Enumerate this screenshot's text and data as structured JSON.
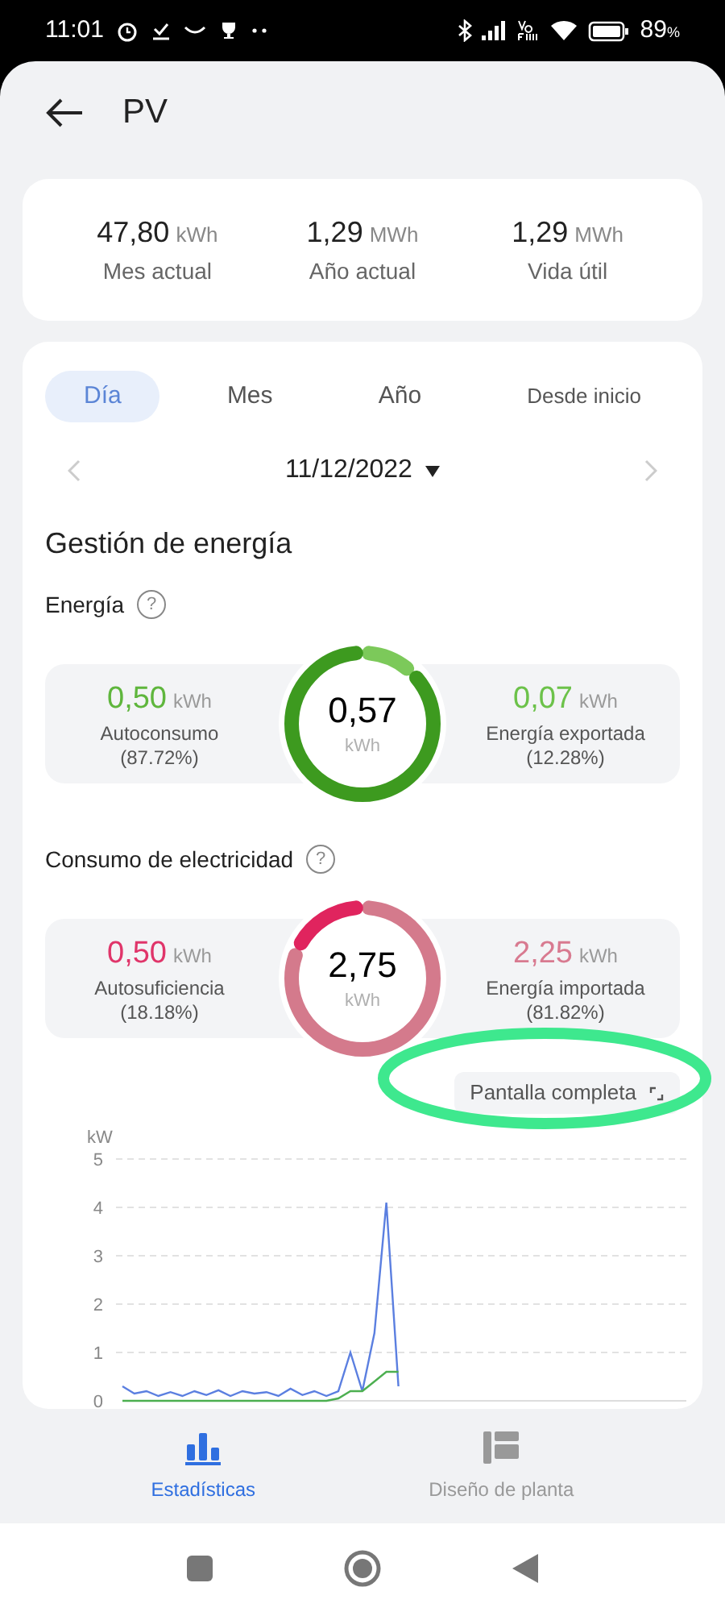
{
  "status_bar": {
    "time": "11:01",
    "battery": "89",
    "battery_unit": "%"
  },
  "header": {
    "title": "PV"
  },
  "summary": [
    {
      "value": "47,80",
      "unit": "kWh",
      "label": "Mes actual"
    },
    {
      "value": "1,29",
      "unit": "MWh",
      "label": "Año actual"
    },
    {
      "value": "1,29",
      "unit": "MWh",
      "label": "Vida útil"
    }
  ],
  "period_tabs": [
    {
      "label": "Día",
      "selected": true
    },
    {
      "label": "Mes",
      "selected": false
    },
    {
      "label": "Año",
      "selected": false
    },
    {
      "label": "Desde inicio",
      "selected": false
    }
  ],
  "date": "11/12/2022",
  "section_title": "Gestión de energía",
  "gauges": [
    {
      "kind": "green",
      "title": "Energía",
      "help_icon": "?",
      "total": "0,57",
      "total_unit": "kWh",
      "left": {
        "value": "0,50",
        "unit": "kWh",
        "label": "Autoconsumo",
        "percent": "(87.72%)"
      },
      "right": {
        "value": "0,07",
        "unit": "kWh",
        "label": "Energía exportada",
        "percent": "(12.28%)"
      }
    },
    {
      "kind": "pink",
      "title": "Consumo de electricidad",
      "help_icon": "?",
      "total": "2,75",
      "total_unit": "kWh",
      "left": {
        "value": "0,50",
        "unit": "kWh",
        "label": "Autosuficiencia",
        "percent": "(18.18%)"
      },
      "right": {
        "value": "2,25",
        "unit": "kWh",
        "label": "Energía importada",
        "percent": "(81.82%)"
      }
    }
  ],
  "fullscreen_button": "Pantalla completa",
  "chart": {
    "chart_data": {
      "type": "line",
      "ylabel": "kW",
      "ylim": [
        0,
        5
      ],
      "yticks": [
        0,
        1,
        2,
        3,
        4,
        5
      ],
      "grid": true,
      "series": [
        {
          "color": "#5b7fe0",
          "values": [
            0.3,
            0.15,
            0.2,
            0.1,
            0.18,
            0.1,
            0.2,
            0.12,
            0.22,
            0.1,
            0.2,
            0.15,
            0.18,
            0.1,
            0.25,
            0.12,
            0.2,
            0.1,
            0.2,
            1.0,
            0.2,
            1.4,
            4.1,
            0.3,
            null,
            null,
            null,
            null,
            null,
            null,
            null,
            null,
            null,
            null,
            null,
            null,
            null,
            null,
            null,
            null,
            null,
            null,
            null,
            null,
            null,
            null,
            null,
            null
          ]
        },
        {
          "color": "#4caf50",
          "values": [
            0,
            0,
            0,
            0,
            0,
            0,
            0,
            0,
            0,
            0,
            0,
            0,
            0,
            0,
            0,
            0,
            0,
            0,
            0.05,
            0.2,
            0.2,
            0.4,
            0.6,
            0.6,
            null,
            null,
            null,
            null,
            null,
            null,
            null,
            null,
            null,
            null,
            null,
            null,
            null,
            null,
            null,
            null,
            null,
            null,
            null,
            null,
            null,
            null,
            null,
            null
          ]
        }
      ]
    }
  },
  "bottom_tabs": [
    {
      "label": "Estadísticas",
      "selected": true
    },
    {
      "label": "Diseño de planta",
      "selected": false
    }
  ]
}
